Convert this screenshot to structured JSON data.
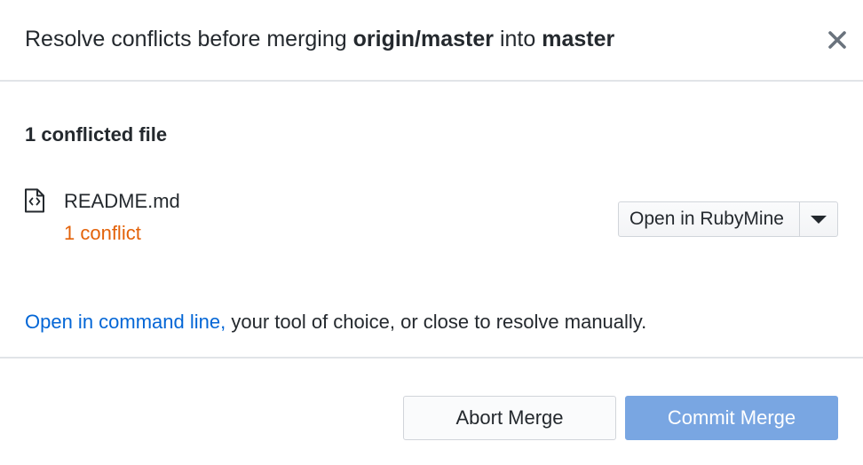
{
  "dialog": {
    "title_prefix": "Resolve conflicts before merging",
    "source_branch": "origin/master",
    "title_connector": "into",
    "target_branch": "master",
    "close_icon": "close-icon"
  },
  "conflicts": {
    "heading": "1 conflicted file",
    "files": [
      {
        "name": "README.md",
        "status": "1 conflict",
        "icon": "file-code-icon",
        "open_button_label": "Open in RubyMine",
        "dropdown_icon": "caret-down-icon"
      }
    ]
  },
  "hint": {
    "link_text": "Open in command line,",
    "rest_text": " your tool of choice, or close to resolve manually."
  },
  "footer": {
    "abort_label": "Abort Merge",
    "commit_label": "Commit Merge"
  },
  "colors": {
    "conflict_text": "#e36209",
    "link": "#0366d6",
    "primary_button_disabled": "#79a6e2"
  }
}
